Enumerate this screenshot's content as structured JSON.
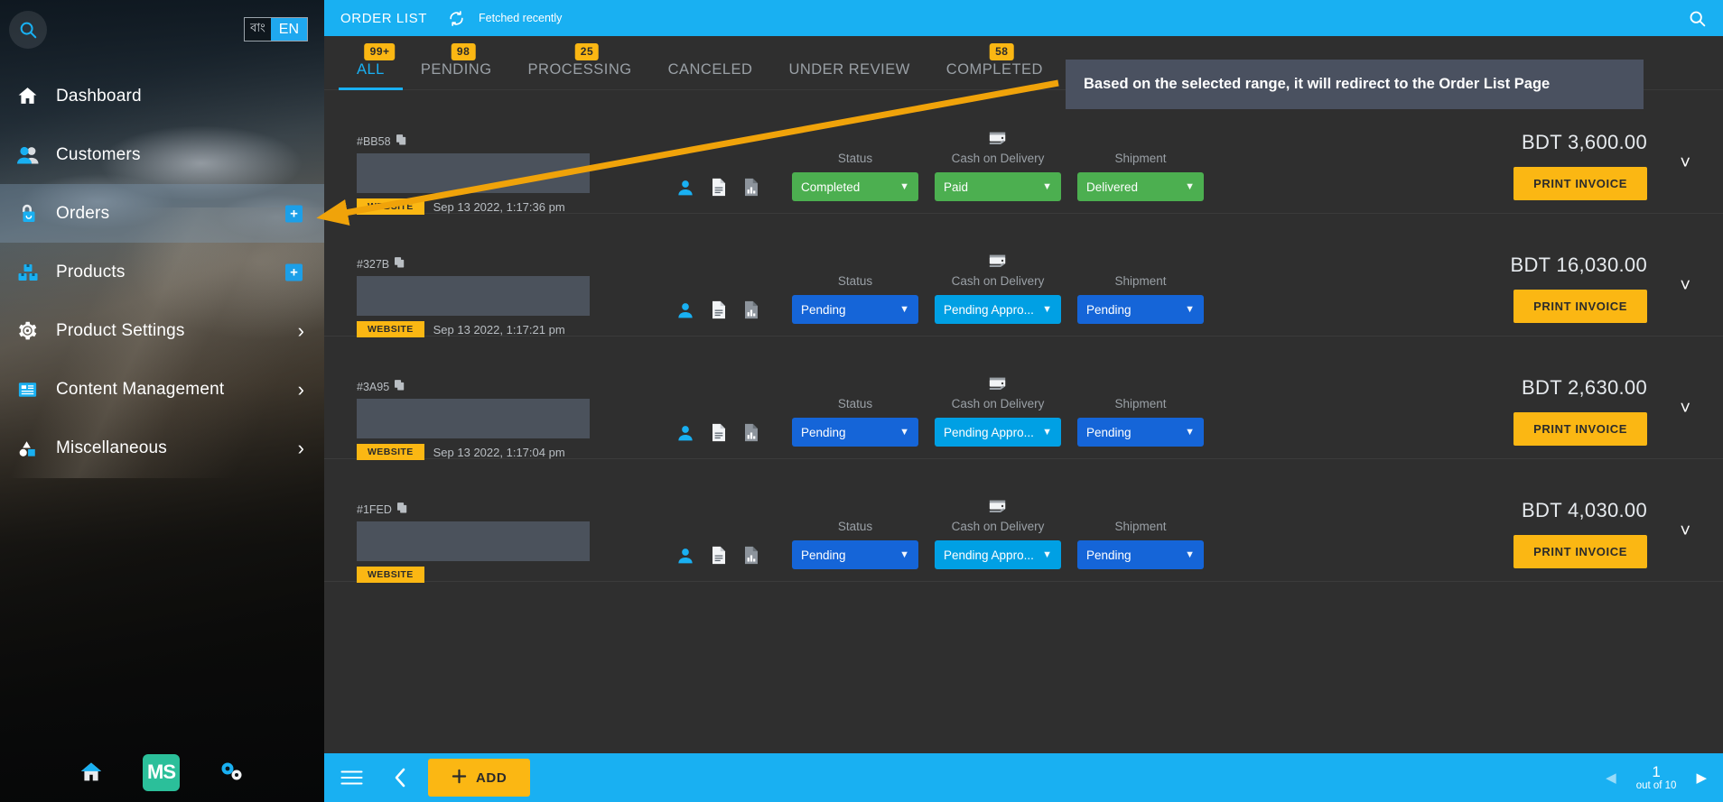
{
  "sidebar": {
    "search_icon": "search-icon",
    "language": {
      "bn_label": "বাং",
      "en_label": "EN",
      "active": "EN"
    },
    "items": [
      {
        "label": "Dashboard",
        "icon": "home-icon",
        "active": false,
        "affordance": "none"
      },
      {
        "label": "Customers",
        "icon": "customers-icon",
        "active": false,
        "affordance": "none"
      },
      {
        "label": "Orders",
        "icon": "shopping-bag-icon",
        "active": true,
        "affordance": "plus"
      },
      {
        "label": "Products",
        "icon": "boxes-icon",
        "active": false,
        "affordance": "plus"
      },
      {
        "label": "Product Settings",
        "icon": "gear-icon",
        "active": false,
        "affordance": "chevron"
      },
      {
        "label": "Content Management",
        "icon": "newspaper-icon",
        "active": false,
        "affordance": "chevron"
      },
      {
        "label": "Miscellaneous",
        "icon": "shapes-icon",
        "active": false,
        "affordance": "chevron"
      }
    ],
    "footer": {
      "home_icon": "home-icon",
      "logo_text": "MS",
      "settings_icon": "gears-icon"
    }
  },
  "topbar": {
    "title": "ORDER LIST",
    "refresh_icon": "refresh-icon",
    "fetched_text": "Fetched recently",
    "search_icon": "search-icon"
  },
  "tabs": [
    {
      "label": "ALL",
      "badge": "99+",
      "active": true
    },
    {
      "label": "PENDING",
      "badge": "98",
      "active": false
    },
    {
      "label": "PROCESSING",
      "badge": "25",
      "active": false
    },
    {
      "label": "CANCELED",
      "badge": "",
      "active": false
    },
    {
      "label": "UNDER REVIEW",
      "badge": "",
      "active": false
    },
    {
      "label": "COMPLETED",
      "badge": "58",
      "active": false
    }
  ],
  "callout": {
    "text": "Based on the selected range, it will redirect to the Order List Page",
    "background": "#4a5160",
    "arrow_color": "#f0a30a"
  },
  "field_labels": {
    "status": "Status",
    "cod": "Cash on Delivery",
    "shipment": "Shipment",
    "cod_icon": "wallet-icon"
  },
  "row_actions": {
    "customer_icon": "user-icon",
    "invoice_icon": "document-icon",
    "report_icon": "chart-icon",
    "print_label": "PRINT INVOICE",
    "expand_icon": "chevron-down-icon",
    "copy_icon": "copy-icon"
  },
  "orders": [
    {
      "id": "#BB58",
      "source": "WEBSITE",
      "date": "Sep 13 2022, 1:17:36 pm",
      "status": {
        "value": "Completed",
        "color": "green"
      },
      "cod": {
        "value": "Paid",
        "color": "green"
      },
      "shipment": {
        "value": "Delivered",
        "color": "green"
      },
      "price": "BDT 3,600.00"
    },
    {
      "id": "#327B",
      "source": "WEBSITE",
      "date": "Sep 13 2022, 1:17:21 pm",
      "status": {
        "value": "Pending",
        "color": "blue"
      },
      "cod": {
        "value": "Pending Appro...",
        "color": "cyan"
      },
      "shipment": {
        "value": "Pending",
        "color": "blue"
      },
      "price": "BDT 16,030.00"
    },
    {
      "id": "#3A95",
      "source": "WEBSITE",
      "date": "Sep 13 2022, 1:17:04 pm",
      "status": {
        "value": "Pending",
        "color": "blue"
      },
      "cod": {
        "value": "Pending Appro...",
        "color": "cyan"
      },
      "shipment": {
        "value": "Pending",
        "color": "blue"
      },
      "price": "BDT 2,630.00"
    },
    {
      "id": "#1FED",
      "source": "WEBSITE",
      "date": "",
      "status": {
        "value": "Pending",
        "color": "blue"
      },
      "cod": {
        "value": "Pending Appro...",
        "color": "cyan"
      },
      "shipment": {
        "value": "Pending",
        "color": "blue"
      },
      "price": "BDT 4,030.00"
    }
  ],
  "bottombar": {
    "menu_icon": "hamburger-icon",
    "back_icon": "chevron-left-icon",
    "add_label": "ADD",
    "add_icon": "plus-icon",
    "pager": {
      "prev_icon": "triangle-left-icon",
      "page": "1",
      "total_text": "out of 10",
      "next_icon": "triangle-right-icon"
    }
  }
}
